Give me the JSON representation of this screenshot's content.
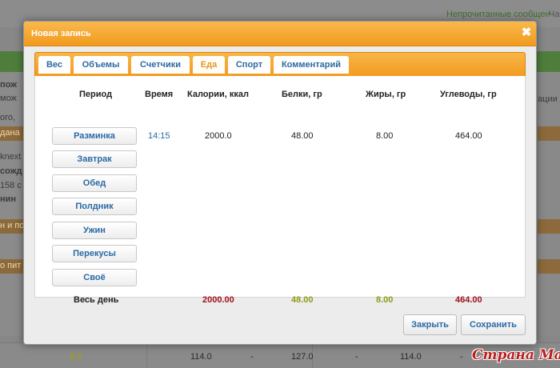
{
  "background": {
    "unread_messages": "Непрочитанные сообщен",
    "chat_fragment": "Ча",
    "fragments": [
      "пож",
      "мож",
      "ого,",
      "дана",
      "knext",
      "сожд",
      "158 с",
      "нин",
      "н и по",
      "о пит",
      "ации"
    ],
    "bottom_row": [
      "0.0",
      "114.0",
      "-",
      "127.0",
      "-",
      "114.0",
      "-"
    ],
    "watermark": "Страна Мам"
  },
  "modal": {
    "title": "Новая запись",
    "close_glyph": "✖"
  },
  "tabs": [
    "Вес",
    "Объемы",
    "Счетчики",
    "Еда",
    "Спорт",
    "Комментарий"
  ],
  "table": {
    "headers": [
      "Период",
      "Время",
      "Калории, ккал",
      "Белки, гр",
      "Жиры, гр",
      "Углеводы, гр"
    ],
    "periods": [
      "Разминка",
      "Завтрак",
      "Обед",
      "Полдник",
      "Ужин",
      "Перекусы",
      "Своё"
    ],
    "first_row": {
      "time": "14:15",
      "calories": "2000.0",
      "protein": "48.00",
      "fat": "8.00",
      "carbs": "464.00"
    },
    "total_label": "Весь день",
    "totals": {
      "calories": "2000.00",
      "protein": "48.00",
      "fat": "8.00",
      "carbs": "464.00"
    }
  },
  "colors": {
    "accent_orange": "#f19a1e",
    "link_blue": "#2b6aa3",
    "total_red": "#a0101c",
    "total_olive": "#8f9a18"
  },
  "footer": {
    "close_label": "Закрыть",
    "save_label": "Сохранить"
  }
}
